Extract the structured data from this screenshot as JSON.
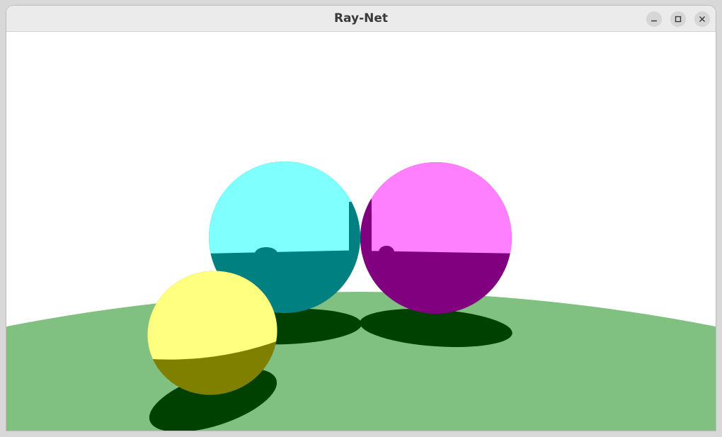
{
  "window": {
    "title": "Ray-Net"
  },
  "controls": {
    "minimize_icon": "minimize-icon",
    "maximize_icon": "maximize-icon",
    "close_icon": "close-icon"
  },
  "scene": {
    "colors": {
      "sky": "#ffffff",
      "ground": "#80c080",
      "shadow": "#004000",
      "cyan_lit": "#80ffff",
      "cyan_dark": "#008080",
      "magenta_lit": "#ff80ff",
      "magenta_dark": "#800080",
      "yellow_lit": "#ffff80",
      "yellow_dark": "#808000"
    }
  }
}
